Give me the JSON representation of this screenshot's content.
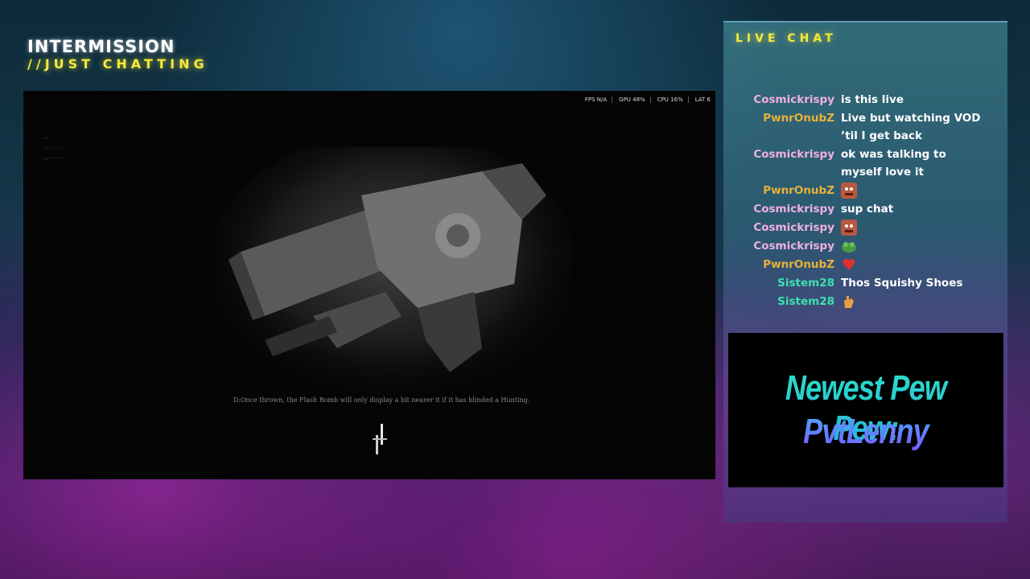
{
  "overlay": {
    "title": "INTERMISSION",
    "subtitle": "//JUST CHATTING"
  },
  "game": {
    "perf": [
      "FPS N/A",
      "GPU 48%",
      "CPU 16%",
      "LAT 6"
    ],
    "tip": "D:Once thrown, the Flash Bomb will only display a bit nearer it if it has blinded a Hunting."
  },
  "chat": {
    "header": "LIVE CHAT",
    "messages": [
      {
        "user": "Cosmickrispy",
        "color": "#f0b0e0",
        "text": "is this live",
        "emote": ""
      },
      {
        "user": "PwnrOnubZ",
        "color": "#e8b13a",
        "text": "Live but watching VOD ’til I get back",
        "emote": ""
      },
      {
        "user": "Cosmickrispy",
        "color": "#f0b0e0",
        "text": "ok was talking to myself love it",
        "emote": ""
      },
      {
        "user": "PwnrOnubZ",
        "color": "#e8b13a",
        "text": "",
        "emote": "face-emote"
      },
      {
        "user": "Cosmickrispy",
        "color": "#f0b0e0",
        "text": "sup chat",
        "emote": ""
      },
      {
        "user": "Cosmickrispy",
        "color": "#f0b0e0",
        "text": "",
        "emote": "face-emote"
      },
      {
        "user": "Cosmickrispy",
        "color": "#f0b0e0",
        "text": "",
        "emote": "frog-emote"
      },
      {
        "user": "PwnrOnubZ",
        "color": "#e8b13a",
        "text": "",
        "emote": "heart-emote"
      },
      {
        "user": "Sistem28",
        "color": "#3ee0b0",
        "text": "Thos Squishy Shoes",
        "emote": ""
      },
      {
        "user": "Sistem28",
        "color": "#3ee0b0",
        "text": "",
        "emote": "hand-emote"
      }
    ]
  },
  "promo": {
    "line1": "Newest Pew Pew:",
    "line2": "PvtLenny"
  }
}
